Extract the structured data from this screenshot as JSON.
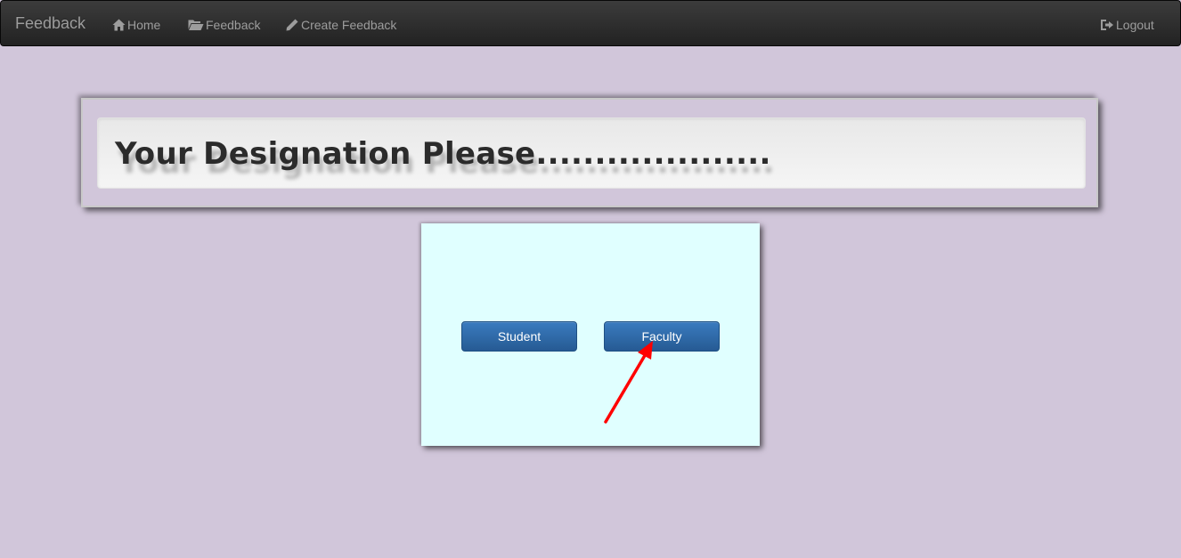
{
  "navbar": {
    "brand": "Feedback",
    "items": [
      {
        "label": "Home",
        "icon": "home-icon"
      },
      {
        "label": "Feedback",
        "icon": "folder-open-icon"
      },
      {
        "label": "Create Feedback",
        "icon": "pencil-icon"
      }
    ],
    "logout": {
      "label": "Logout",
      "icon": "logout-icon"
    }
  },
  "banner": {
    "title": "Your Designation Please...................."
  },
  "card": {
    "student_label": "Student",
    "faculty_label": "Faculty"
  },
  "colors": {
    "page_background": "#d1c6da",
    "card_background": "#e0ffff",
    "button_primary": "#2e6da4",
    "annotation_arrow": "#ff0000"
  }
}
